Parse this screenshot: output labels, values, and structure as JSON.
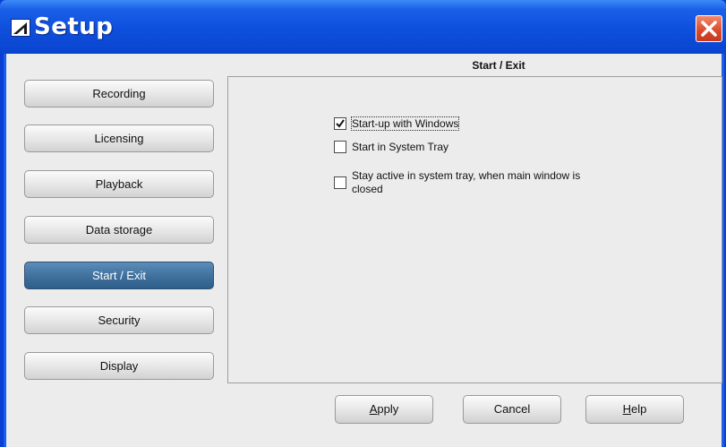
{
  "window": {
    "title": "Setup"
  },
  "section_title": "Start / Exit",
  "nav": {
    "items": [
      {
        "label": "Recording"
      },
      {
        "label": "Licensing"
      },
      {
        "label": "Playback"
      },
      {
        "label": "Data storage"
      },
      {
        "label": "Start / Exit",
        "active": true
      },
      {
        "label": "Security"
      },
      {
        "label": "Display"
      }
    ]
  },
  "options": [
    {
      "label": "Start-up with Windows",
      "checked": true
    },
    {
      "label": "Start in System Tray",
      "checked": false
    },
    {
      "line1": "Stay active in system tray, when main window is",
      "line2": "closed",
      "checked": false
    }
  ],
  "buttons": {
    "apply": {
      "mnemonic": "A",
      "rest": "pply"
    },
    "cancel": {
      "label": "Cancel"
    },
    "help": {
      "mnemonic": "H",
      "rest": "elp"
    }
  },
  "colors": {
    "title_bar": "#0d4fdc",
    "active_nav": "#3f6f9c",
    "close": "#d9482a"
  },
  "icons": {
    "app": "setup-icon",
    "close": "close-icon",
    "check": "checkmark-icon"
  }
}
